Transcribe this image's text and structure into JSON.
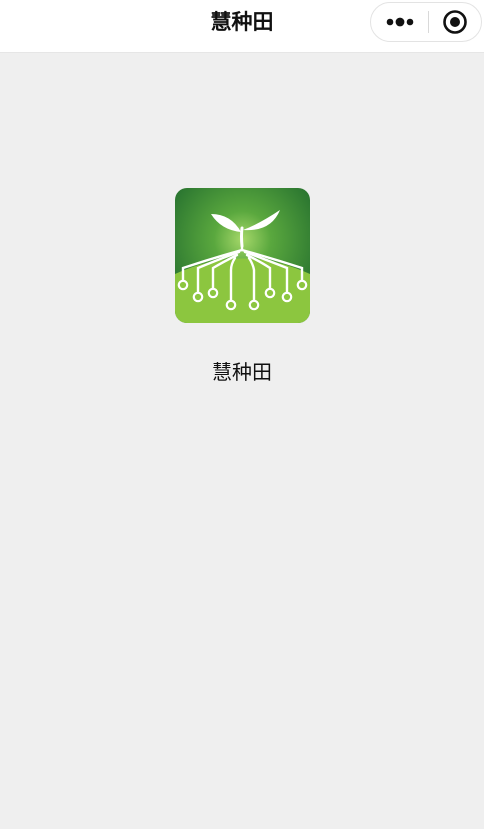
{
  "nav": {
    "title": "慧种田",
    "more_icon": "more-dots-icon",
    "close_icon": "target-close-icon"
  },
  "app": {
    "name": "慧种田",
    "logo_icon": "sprout-circuit-logo"
  },
  "colors": {
    "page_background": "#efefef",
    "nav_background": "#ffffff",
    "logo_dark_green": "#2f7d32",
    "logo_light_green": "#8cc63f",
    "text": "#111111"
  }
}
